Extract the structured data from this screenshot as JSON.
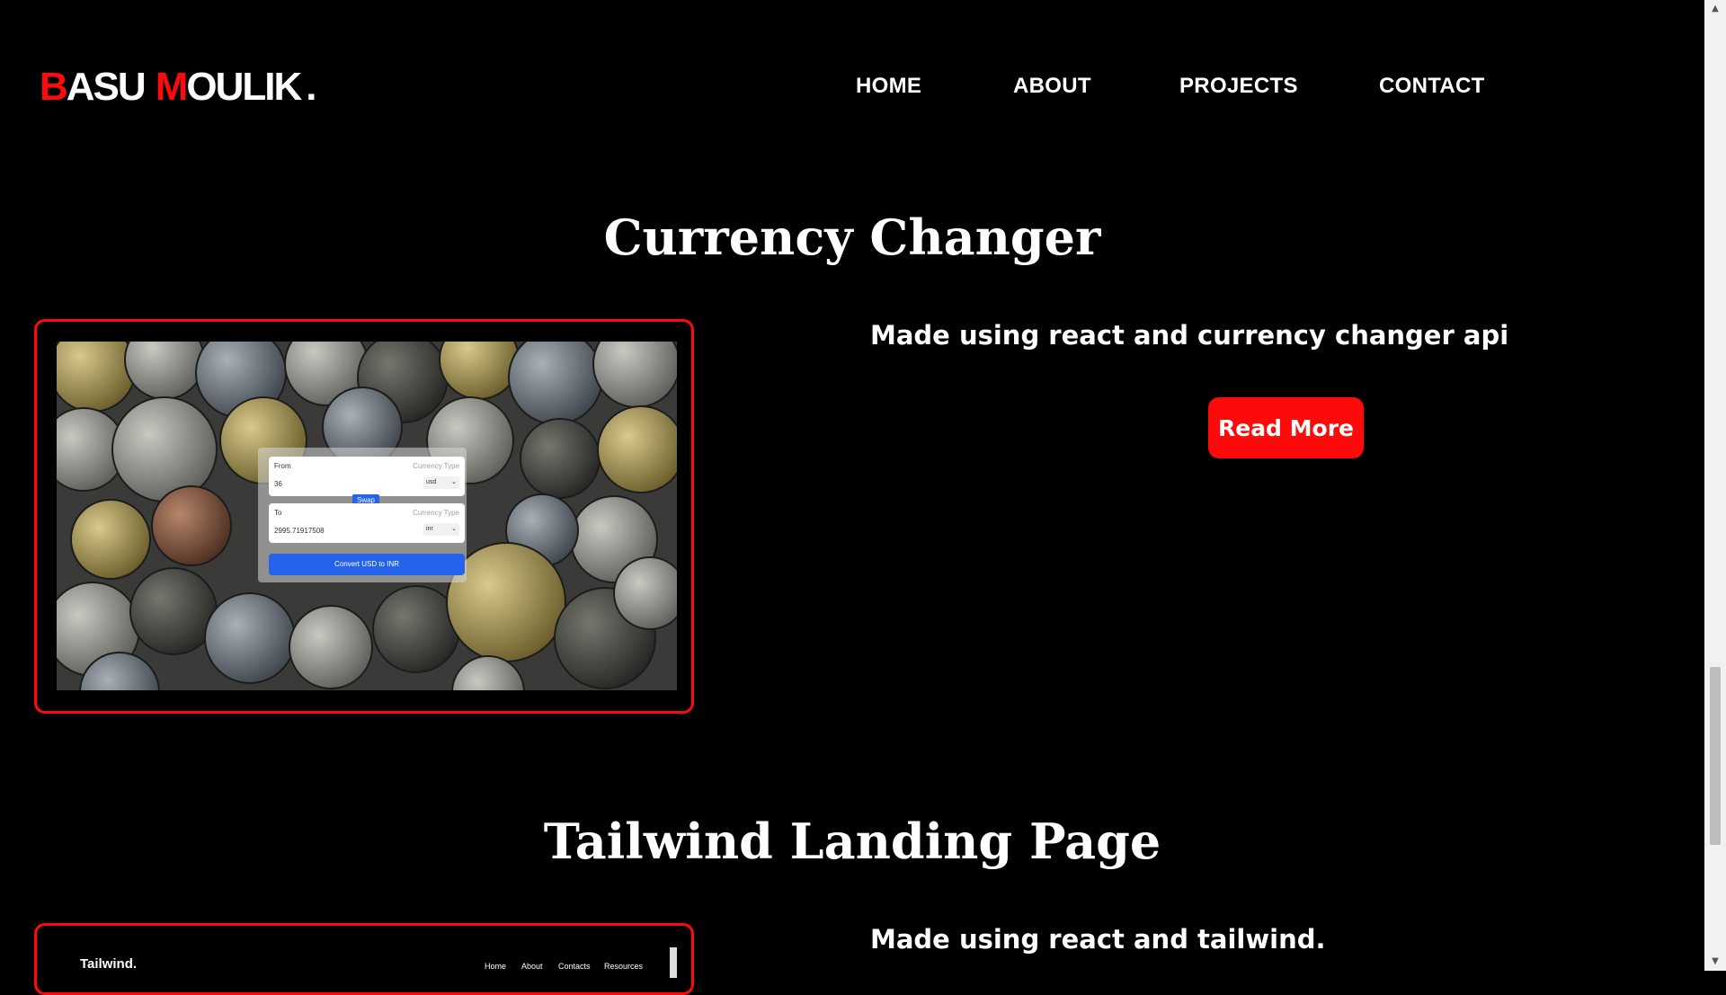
{
  "header": {
    "logo_first_initial": "B",
    "logo_first_rest": "ASU",
    "logo_second_initial": "M",
    "logo_second_rest": "OULIK",
    "logo_dot": ".",
    "nav": [
      "HOME",
      "ABOUT",
      "PROJECTS",
      "CONTACT"
    ]
  },
  "projects": [
    {
      "title": "Currency Changer",
      "description": "Made using react and currency changer api",
      "button_label": "Read More",
      "preview": {
        "from_label": "From",
        "from_currency_type_label": "Currency Type",
        "from_value": "36",
        "from_currency": "usd",
        "swap_label": "Swap",
        "to_label": "To",
        "to_currency_type_label": "Currency Type",
        "to_value": "2995.71917508",
        "to_currency": "inr",
        "convert_label": "Convert USD to INR"
      }
    },
    {
      "title": "Tailwind Landing Page",
      "description": "Made using react and tailwind.",
      "preview": {
        "brand": "Tailwind.",
        "nav": [
          "Home",
          "About",
          "Contacts",
          "Resources"
        ]
      }
    }
  ],
  "colors": {
    "accent": "#ff0a0a",
    "background": "#000000",
    "preview_button": "#2563eb"
  },
  "icons": {
    "chevron": "chevron-down-icon",
    "scroll_up": "triangle-up",
    "scroll_down": "triangle-down"
  }
}
